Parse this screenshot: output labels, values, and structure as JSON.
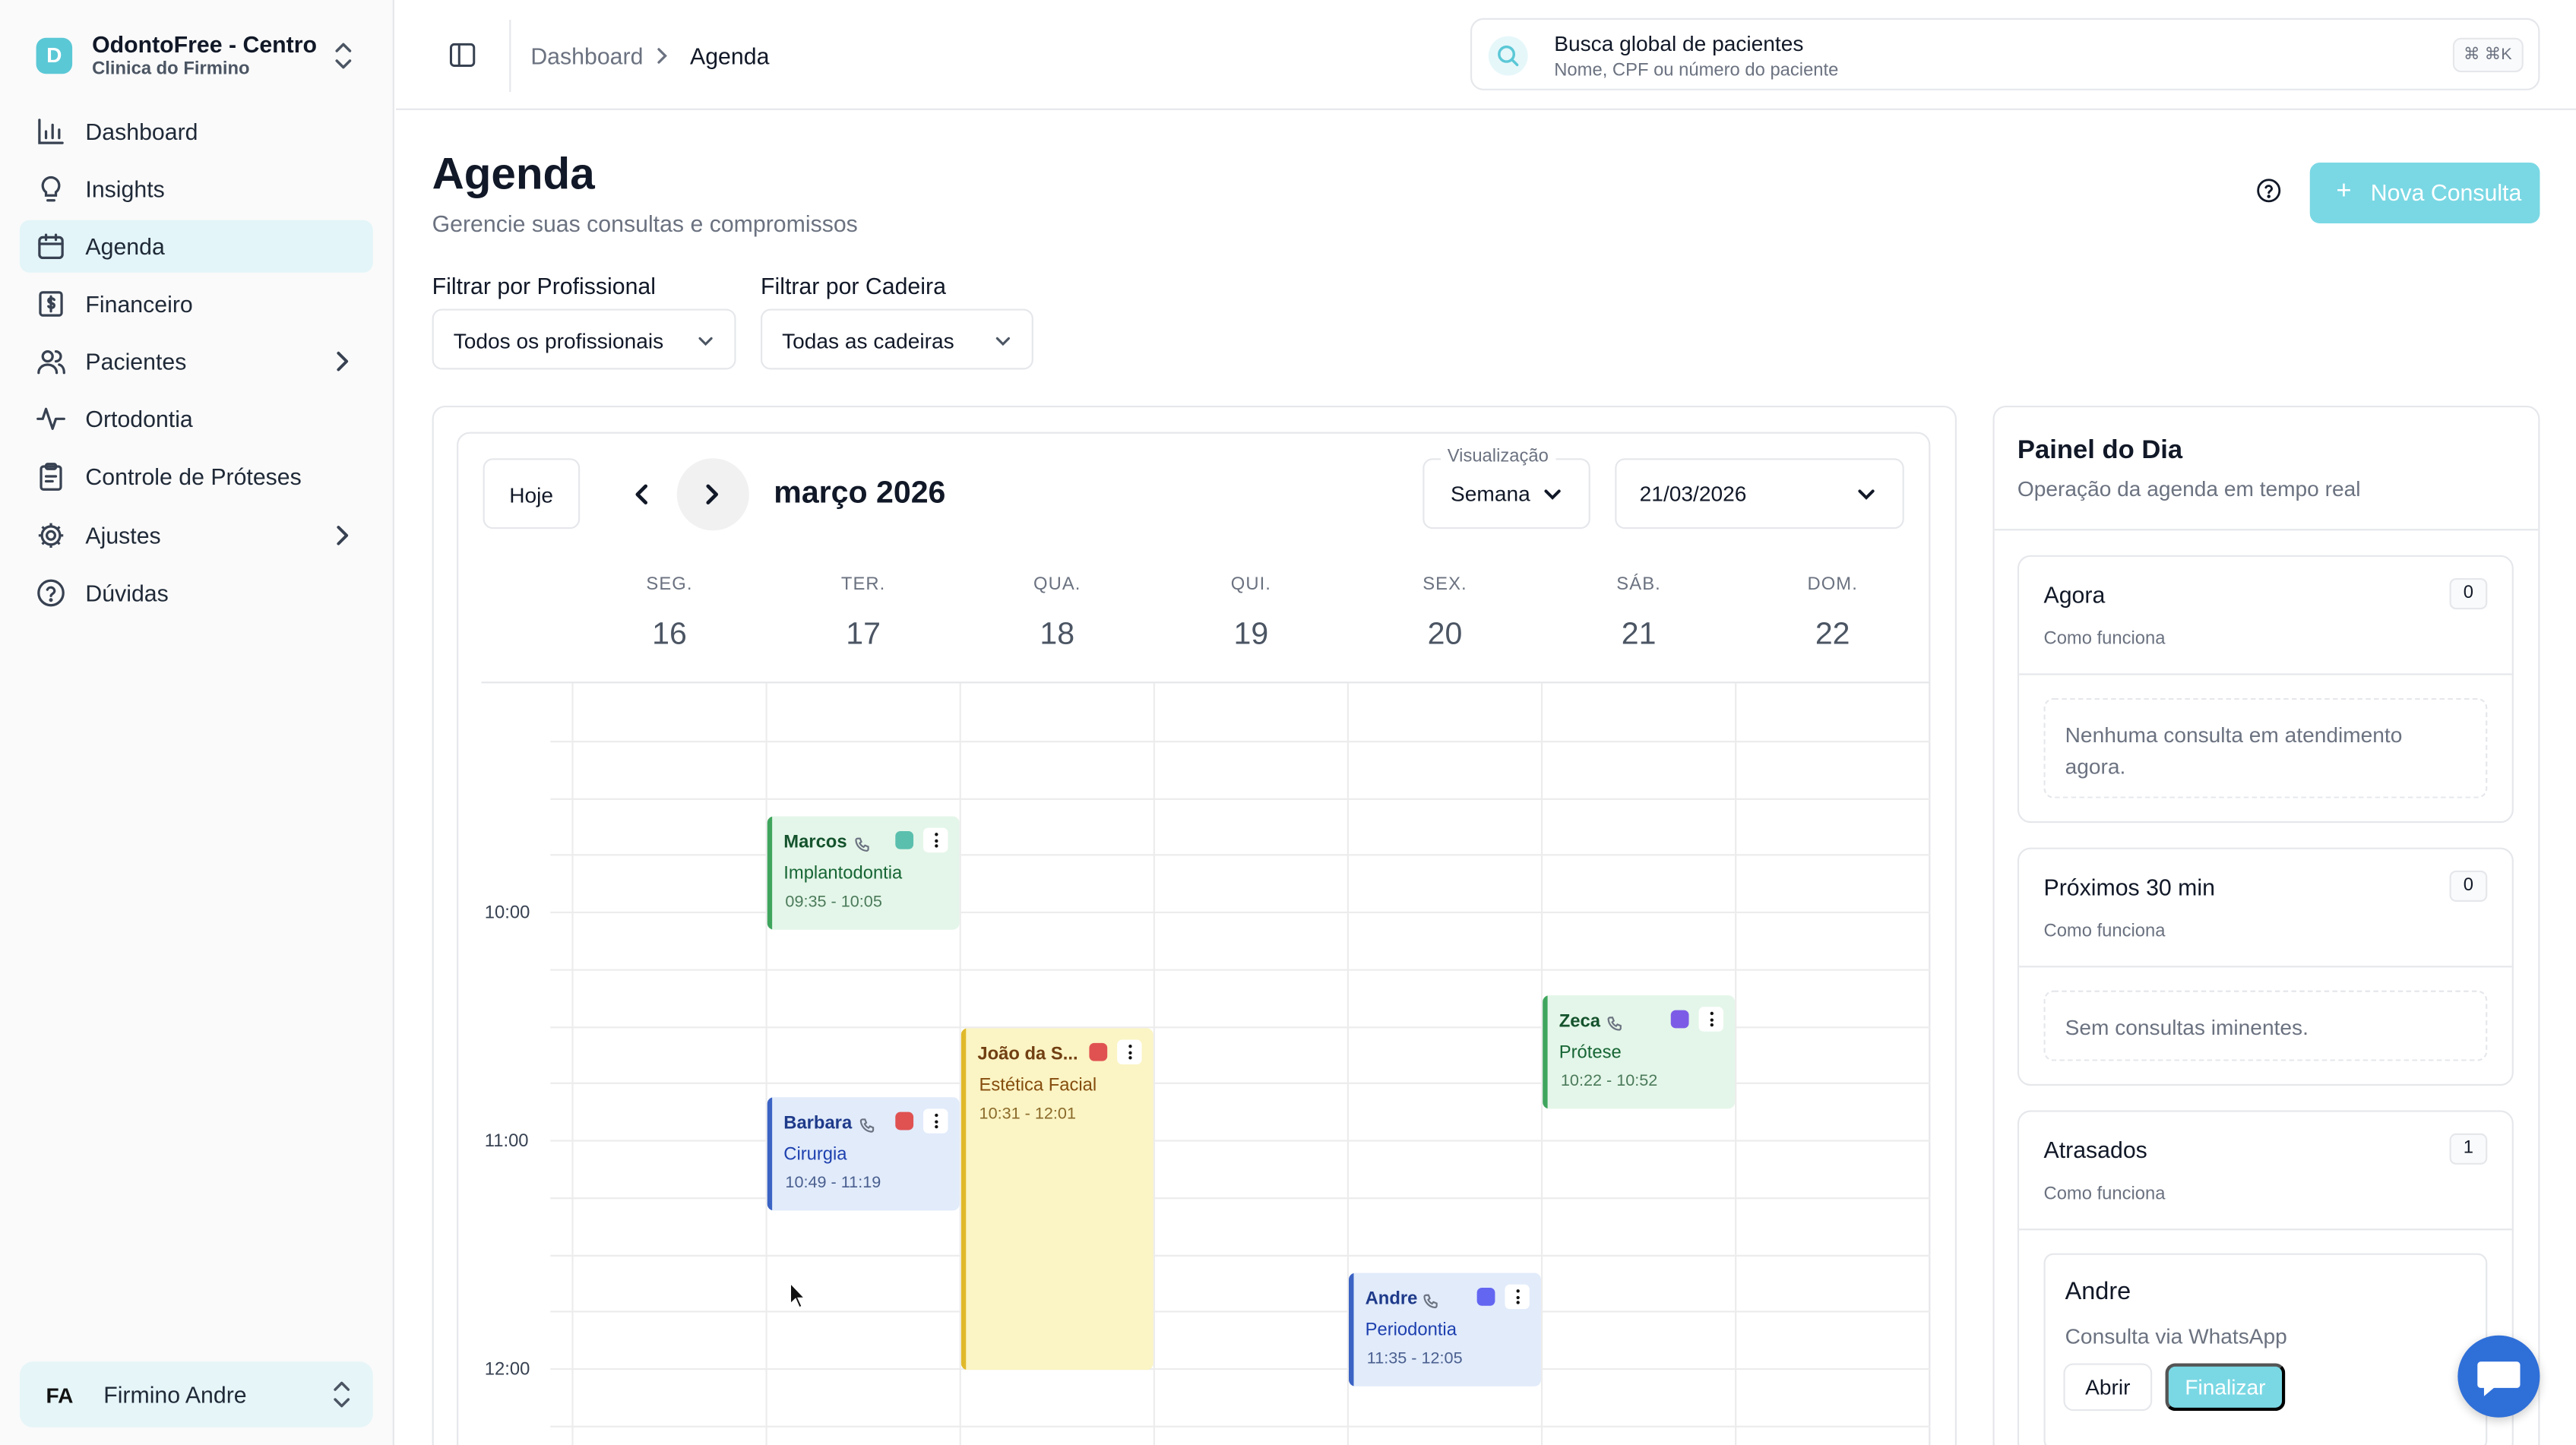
{
  "app": {
    "name": "OdontoFree - Centro",
    "clinic": "Clinica do Firmino",
    "logo_letter": "D",
    "accent": "#5bc8d6"
  },
  "sidebar": {
    "items": [
      {
        "label": "Dashboard",
        "icon": "bar-chart-icon"
      },
      {
        "label": "Insights",
        "icon": "lightbulb-icon"
      },
      {
        "label": "Agenda",
        "icon": "calendar-icon",
        "active": true
      },
      {
        "label": "Financeiro",
        "icon": "dollar-icon"
      },
      {
        "label": "Pacientes",
        "icon": "users-icon",
        "has_children": true
      },
      {
        "label": "Ortodontia",
        "icon": "activity-icon"
      },
      {
        "label": "Controle de Próteses",
        "icon": "clipboard-icon"
      },
      {
        "label": "Ajustes",
        "icon": "gear-icon",
        "has_children": true
      },
      {
        "label": "Dúvidas",
        "icon": "help-circle-icon"
      }
    ],
    "user": {
      "initials": "FA",
      "name": "Firmino Andre"
    }
  },
  "header": {
    "breadcrumb": [
      "Dashboard",
      "Agenda"
    ],
    "search": {
      "title": "Busca global de pacientes",
      "placeholder": "Nome, CPF ou número do paciente",
      "shortcut": "⌘ ⌘K"
    }
  },
  "page": {
    "title": "Agenda",
    "subtitle": "Gerencie suas consultas e compromissos",
    "new_button": "Nova Consulta"
  },
  "filters": {
    "professional": {
      "label": "Filtrar por Profissional",
      "value": "Todos os profissionais"
    },
    "chair": {
      "label": "Filtrar por Cadeira",
      "value": "Todas as cadeiras"
    }
  },
  "calendar": {
    "today_label": "Hoje",
    "month": "março 2026",
    "view_label": "Visualização",
    "view_value": "Semana",
    "date_value": "21/03/2026",
    "days": [
      {
        "dow": "SEG.",
        "num": "16"
      },
      {
        "dow": "TER.",
        "num": "17"
      },
      {
        "dow": "QUA.",
        "num": "18"
      },
      {
        "dow": "QUI.",
        "num": "19"
      },
      {
        "dow": "SEX.",
        "num": "20"
      },
      {
        "dow": "SÁB.",
        "num": "21"
      },
      {
        "dow": "DOM.",
        "num": "22"
      }
    ],
    "times": [
      "10:00",
      "11:00",
      "12:00"
    ],
    "events": [
      {
        "name": "Marcos",
        "procedure": "Implantodontia",
        "time": "09:35 - 10:05",
        "day": 1,
        "status_color": "#5bbfae",
        "theme": "green"
      },
      {
        "name": "João da S...",
        "procedure": "Estética Facial",
        "time": "10:31 - 12:01",
        "day": 2,
        "status_color": "#e05252",
        "theme": "yellow"
      },
      {
        "name": "Barbara",
        "procedure": "Cirurgia",
        "time": "10:49 - 11:19",
        "day": 1,
        "status_color": "#e05252",
        "theme": "blue"
      },
      {
        "name": "Zeca",
        "procedure": "Prótese",
        "time": "10:22 - 10:52",
        "day": 5,
        "status_color": "#7c5ce6",
        "theme": "green"
      },
      {
        "name": "Andre",
        "procedure": "Periodontia",
        "time": "11:35 - 12:05",
        "day": 4,
        "status_color": "#6366f1",
        "theme": "blue"
      }
    ]
  },
  "day_panel": {
    "title": "Painel do Dia",
    "subtitle": "Operação da agenda em tempo real",
    "how_label": "Como funciona",
    "cards": [
      {
        "title": "Agora",
        "count": "0",
        "empty_text": "Nenhuma consulta em atendimento agora."
      },
      {
        "title": "Próximos 30 min",
        "count": "0",
        "empty_text": "Sem consultas iminentes."
      },
      {
        "title": "Atrasados",
        "count": "1"
      }
    ],
    "late_item": {
      "name": "Andre",
      "description": "Consulta via WhatsApp",
      "open_label": "Abrir",
      "finish_label": "Finalizar"
    }
  }
}
